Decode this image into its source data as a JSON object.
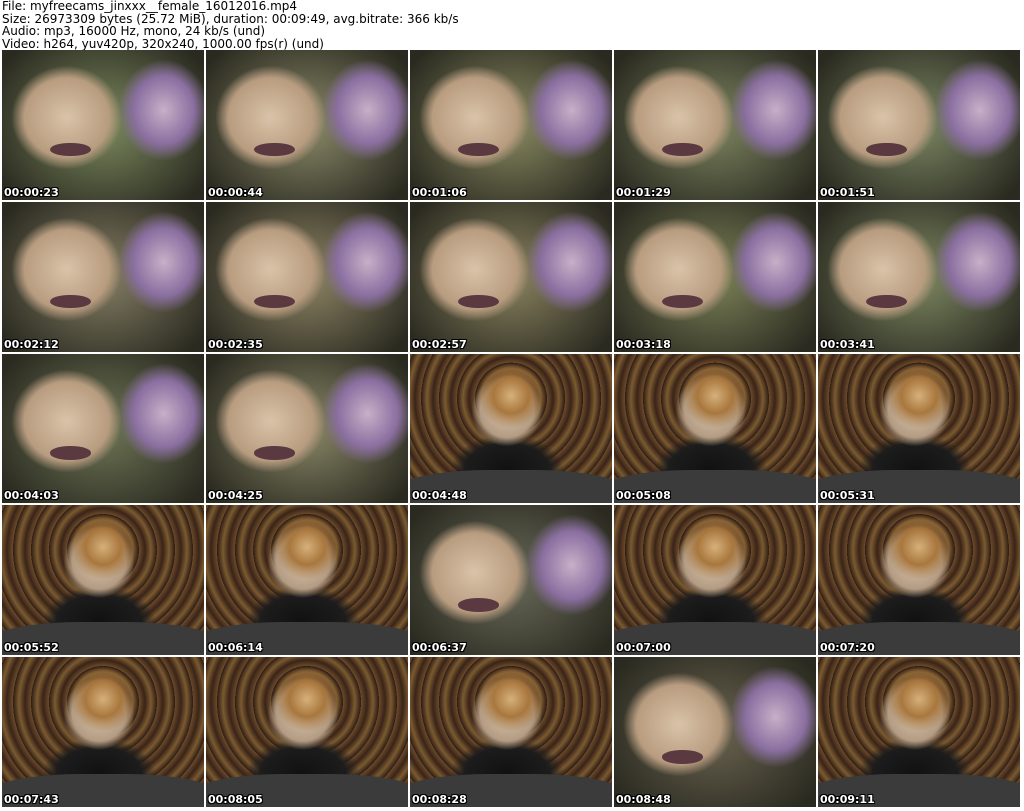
{
  "header": {
    "file_line": "File: myfreecams_jinxxx__female_16012016.mp4",
    "size_line": "Size: 26973309 bytes (25.72 MiB), duration: 00:09:49, avg.bitrate: 366 kb/s",
    "audio_line": "Audio: mp3, 16000 Hz, mono, 24 kb/s (und)",
    "video_line": "Video: h264, yuv420p, 320x240, 1000.00 fps(r) (und)"
  },
  "thumbnails": [
    {
      "timestamp": "00:00:23",
      "scene": "closeup",
      "tint": "#7c8a5e"
    },
    {
      "timestamp": "00:00:44",
      "scene": "closeup",
      "tint": "#8c8a6a"
    },
    {
      "timestamp": "00:01:06",
      "scene": "closeup",
      "tint": "#8a8a62"
    },
    {
      "timestamp": "00:01:29",
      "scene": "closeup",
      "tint": "#7d8560"
    },
    {
      "timestamp": "00:01:51",
      "scene": "closeup",
      "tint": "#7b8663"
    },
    {
      "timestamp": "00:02:12",
      "scene": "closeup",
      "tint": "#857e64"
    },
    {
      "timestamp": "00:02:35",
      "scene": "closeup",
      "tint": "#8f8566"
    },
    {
      "timestamp": "00:02:57",
      "scene": "closeup",
      "tint": "#8b8360"
    },
    {
      "timestamp": "00:03:18",
      "scene": "closeup",
      "tint": "#7c8258"
    },
    {
      "timestamp": "00:03:41",
      "scene": "closeup",
      "tint": "#7e8862"
    },
    {
      "timestamp": "00:04:03",
      "scene": "closeup",
      "tint": "#6f7656"
    },
    {
      "timestamp": "00:04:25",
      "scene": "closeup",
      "tint": "#8a8767"
    },
    {
      "timestamp": "00:04:48",
      "scene": "room",
      "tint": "#4a3a28"
    },
    {
      "timestamp": "00:05:08",
      "scene": "room",
      "tint": "#3e3424"
    },
    {
      "timestamp": "00:05:31",
      "scene": "room",
      "tint": "#463828"
    },
    {
      "timestamp": "00:05:52",
      "scene": "room",
      "tint": "#43332a"
    },
    {
      "timestamp": "00:06:14",
      "scene": "room",
      "tint": "#3a3022"
    },
    {
      "timestamp": "00:06:37",
      "scene": "closeup",
      "tint": "#6a6a5a"
    },
    {
      "timestamp": "00:07:00",
      "scene": "room",
      "tint": "#453828"
    },
    {
      "timestamp": "00:07:20",
      "scene": "room",
      "tint": "#433626"
    },
    {
      "timestamp": "00:07:43",
      "scene": "room",
      "tint": "#433628"
    },
    {
      "timestamp": "00:08:05",
      "scene": "room",
      "tint": "#4a3c2a"
    },
    {
      "timestamp": "00:08:28",
      "scene": "room",
      "tint": "#473a28"
    },
    {
      "timestamp": "00:08:48",
      "scene": "closeup",
      "tint": "#6a6350"
    },
    {
      "timestamp": "00:09:11",
      "scene": "room",
      "tint": "#4b3d2c"
    }
  ]
}
